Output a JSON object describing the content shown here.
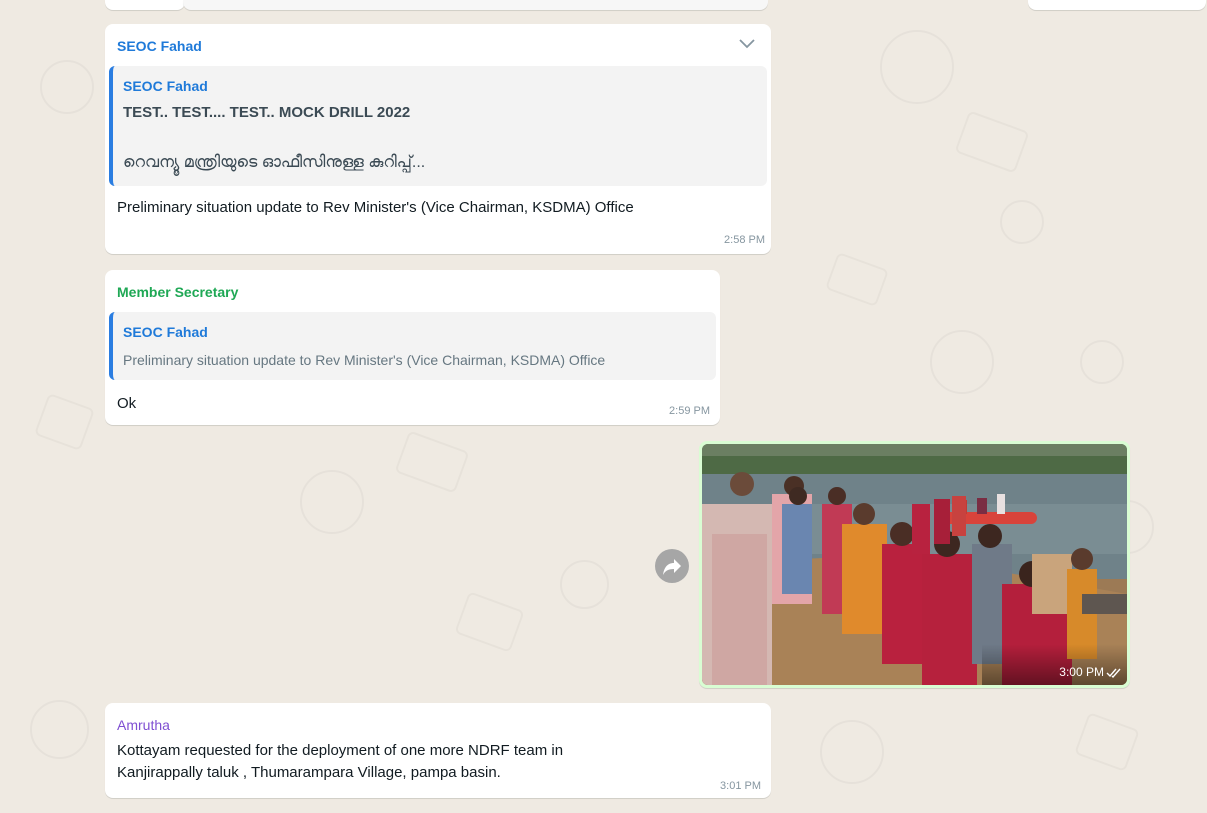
{
  "messages": [
    {
      "sender": "SEOC Fahad",
      "quoted": {
        "sender": "SEOC Fahad",
        "title": "TEST.. TEST.... TEST.. MOCK DRILL 2022",
        "body": "റെവന്യൂ മന്ത്രിയുടെ ഓഫീസിനുള്ള കുറിപ്പ്..."
      },
      "text": "Preliminary situation update to Rev Minister's (Vice Chairman, KSDMA) Office",
      "time": "2:58 PM"
    },
    {
      "sender": "Member Secretary",
      "quoted": {
        "sender": "SEOC Fahad",
        "body": "Preliminary situation update to Rev Minister's (Vice Chairman, KSDMA) Office"
      },
      "text": "Ok",
      "time": "2:59 PM"
    },
    {
      "type": "image",
      "time": "3:00 PM",
      "status": "read",
      "image_description_icon": "rescue-drill-photo"
    },
    {
      "sender": "Amrutha",
      "text_line1": "Kottayam requested for the deployment of one more NDRF team in",
      "text_line2": "Kanjirappally taluk , Thumarampara Village, pampa basin.",
      "time": "3:01 PM"
    }
  ],
  "colors": {
    "wallpaper": "#efeae2",
    "outgoing": "#d9fdd3",
    "sender_blue": "#1f7ad9",
    "sender_green": "#1fa855",
    "sender_purple": "#7f4fd2"
  }
}
